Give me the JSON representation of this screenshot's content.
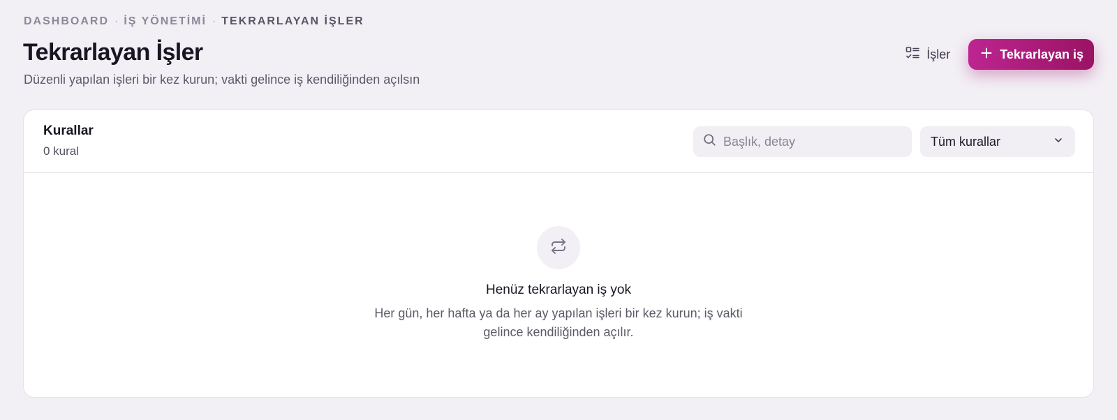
{
  "breadcrumb": [
    "DASHBOARD",
    "İŞ YÖNETİMİ",
    "TEKRARLAYAN İŞLER"
  ],
  "breadcrumb_separator": "·",
  "page": {
    "title": "Tekrarlayan İşler",
    "subtitle": "Düzenli yapılan işleri bir kez kurun; vakti gelince iş kendiliğinden açılsın"
  },
  "actions": {
    "jobs_label": "İşler",
    "jobs_icon": "list-check-icon",
    "new_label": "Tekrarlayan iş",
    "new_icon": "plus-icon",
    "accent_start": "#bd2591",
    "accent_end": "#9a1364"
  },
  "rules": {
    "title": "Kurallar",
    "count": "0 kural",
    "search_placeholder": "Başlık, detay",
    "search_value": "",
    "filter_selected": "Tüm kurallar"
  },
  "empty": {
    "icon": "repeat-icon",
    "title": "Henüz tekrarlayan iş yok",
    "description": "Her gün, her hafta ya da her ay yapılan işleri bir kez kurun; iş vakti gelince kendiliğinden açılır."
  },
  "colors": {
    "background": "#f2eff5",
    "card": "#ffffff",
    "text_primary": "#1a1523",
    "text_muted": "#5e5969"
  }
}
